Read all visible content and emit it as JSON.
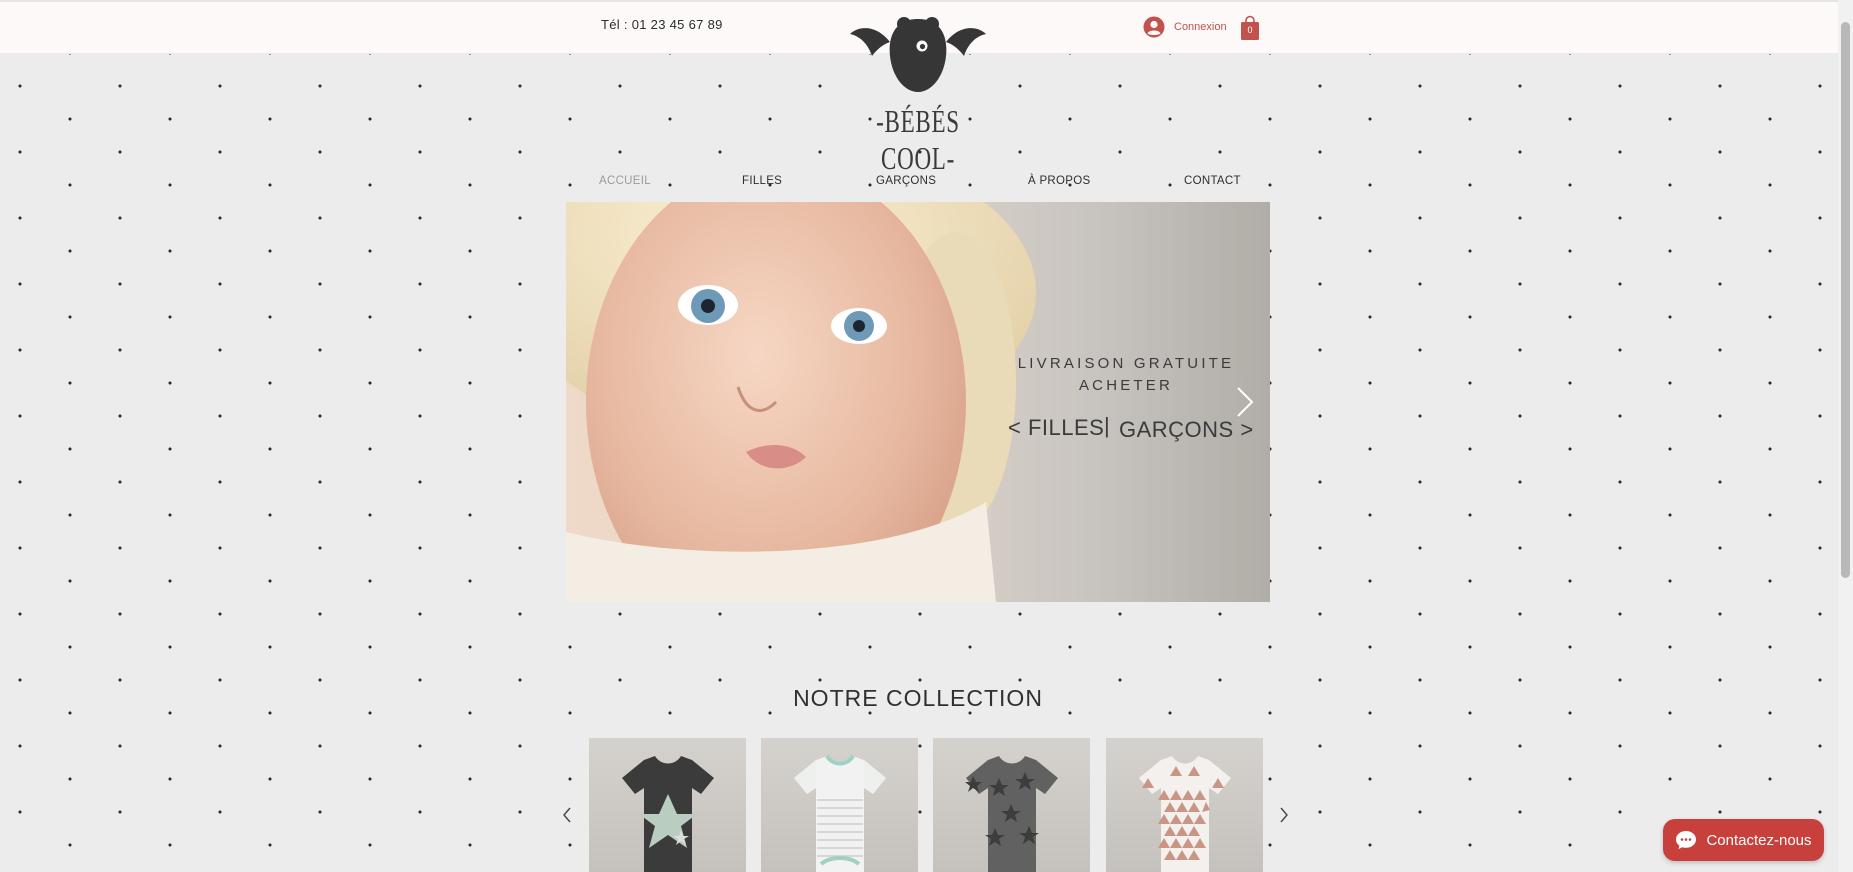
{
  "header": {
    "phone": "Tél : 01 23 45 67 89",
    "login_label": "Connexion",
    "cart_count": "0",
    "brand": "-BÉBÉS COOL-"
  },
  "nav": {
    "items": [
      {
        "label": "ACCUEIL",
        "active": true
      },
      {
        "label": "FILLES",
        "active": false
      },
      {
        "label": "GARÇONS",
        "active": false
      },
      {
        "label": "À PROPOS",
        "active": false
      },
      {
        "label": "CONTACT",
        "active": false
      }
    ]
  },
  "hero": {
    "line1": "LIVRAISON GRATUITE",
    "line2": "ACHETER",
    "left_link": "< FILLES",
    "separator": "|",
    "right_link": "GARÇONS >"
  },
  "collection": {
    "title": "NOTRE COLLECTION",
    "products": [
      {
        "icon": "bodysuit-star-dark"
      },
      {
        "icon": "bodysuit-striped"
      },
      {
        "icon": "bodysuit-stars-grey"
      },
      {
        "icon": "bodysuit-triangles-pink"
      }
    ]
  },
  "chat": {
    "label": "Contactez-nous"
  },
  "colors": {
    "accent": "#c7403b",
    "topbar": "#fcf9f8",
    "background": "#ececec",
    "text": "#2d2d2d"
  }
}
